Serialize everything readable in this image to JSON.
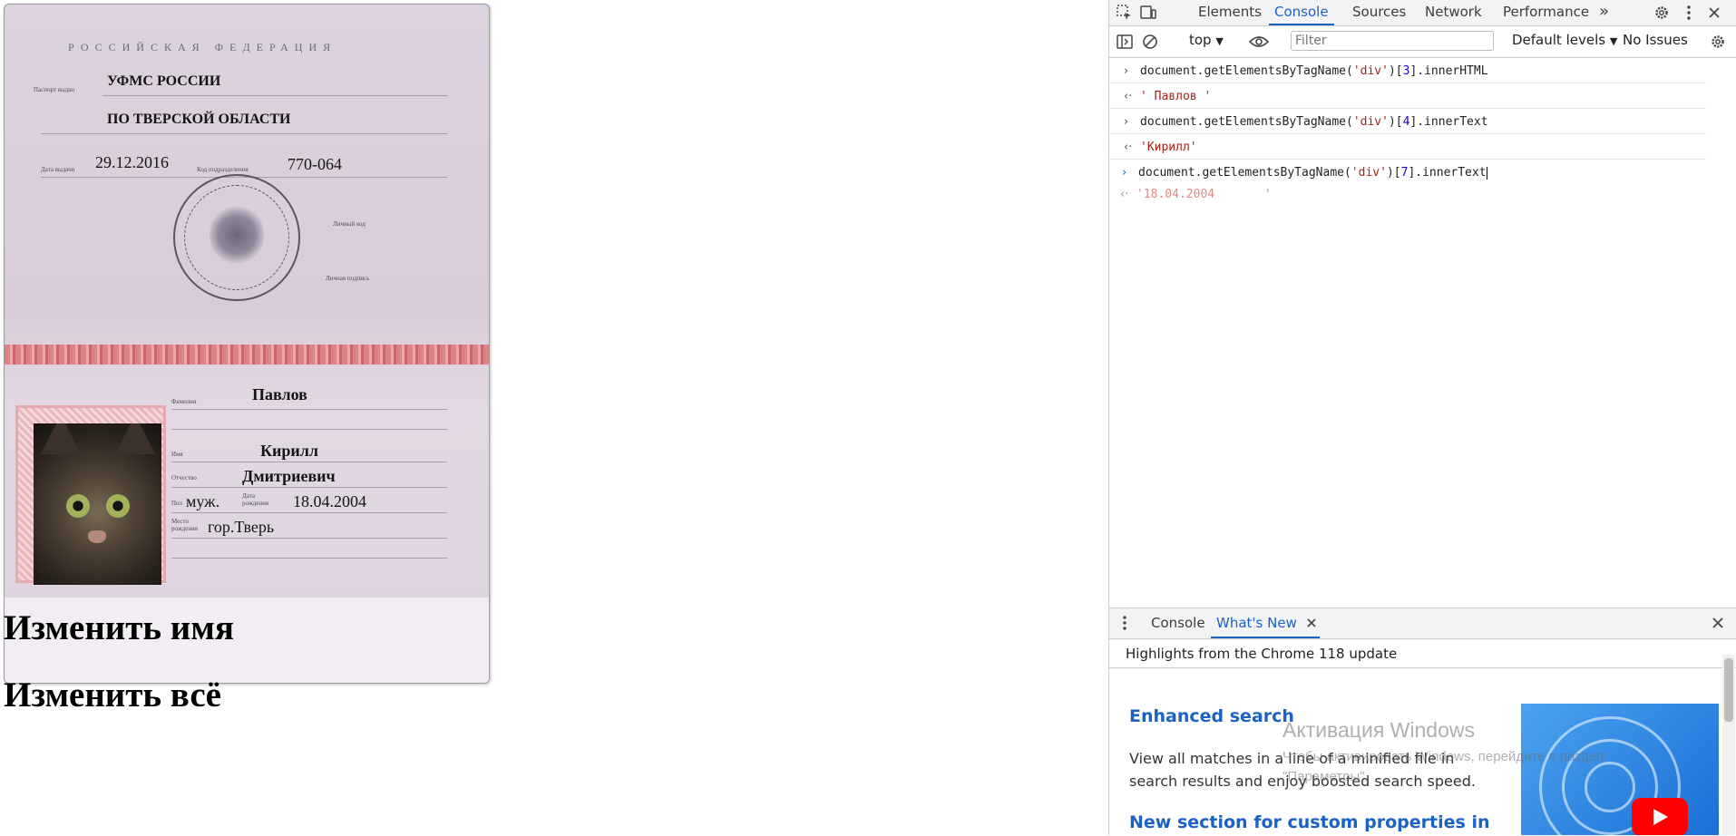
{
  "passport": {
    "country": "РОССИЙСКАЯ ФЕДЕРАЦИЯ",
    "issued_by_line1": "УФМС РОССИИ",
    "issued_by_line2": "ПО ТВЕРСКОЙ ОБЛАСТИ",
    "issue_date": "29.12.2016",
    "division_code": "770-064",
    "surname": "Павлов",
    "given_name": "Кирилл",
    "patronymic": "Дмитриевич",
    "sex": "муж.",
    "birth_date": "18.04.2004",
    "birth_place": "гор.Тверь"
  },
  "page_actions": {
    "change_name": "Изменить имя",
    "change_all": "Изменить всё"
  },
  "devtools": {
    "tabs": [
      "Elements",
      "Console",
      "Sources",
      "Network",
      "Performance"
    ],
    "active_tab": "Console",
    "more_tabs": "»",
    "context": "top",
    "filter_placeholder": "Filter",
    "levels": "Default levels",
    "issues": "No Issues",
    "console": [
      {
        "kind": "input",
        "prefix": "document.getElementsByTagName(",
        "arg": "'div'",
        "index": "3",
        "suffix": ".innerHTML"
      },
      {
        "kind": "output",
        "value": "' Павлов '"
      },
      {
        "kind": "input",
        "prefix": "document.getElementsByTagName(",
        "arg": "'div'",
        "index": "4",
        "suffix": ".innerText"
      },
      {
        "kind": "output",
        "value": "'Кирилл'"
      },
      {
        "kind": "input",
        "prefix": "document.getElementsByTagName(",
        "arg": "'div'",
        "index": "7",
        "suffix": ".innerText"
      },
      {
        "kind": "preview",
        "value": "'18.04.2004       '"
      }
    ],
    "drawer": {
      "tabs": [
        "Console",
        "What's New"
      ],
      "active_tab": "What's New",
      "header": "Highlights from the Chrome 118 update",
      "items": [
        {
          "title": "Enhanced search",
          "body_line1": "View all matches in a line of a minified file in",
          "body_line2": "search results and enjoy boosted search speed."
        },
        {
          "title": "New section for custom properties in"
        }
      ]
    }
  },
  "watermark": {
    "title": "Активация Windows",
    "line1": "Чтобы активировать Windows, перейдите в раздел",
    "line2": "\"Параметры\"."
  },
  "colors": {
    "accent_blue": "#1a62c4",
    "console_string": "#a3221b",
    "console_number": "#1c00cf",
    "passport_band": "#d97b80"
  },
  "icons": [
    "inspect-icon",
    "device-toolbar-icon",
    "settings-gear-icon",
    "kebab-menu-icon",
    "close-icon",
    "sidebar-toggle-icon",
    "clear-console-icon",
    "eye-icon",
    "chevron-down-icon",
    "youtube-play-icon"
  ]
}
